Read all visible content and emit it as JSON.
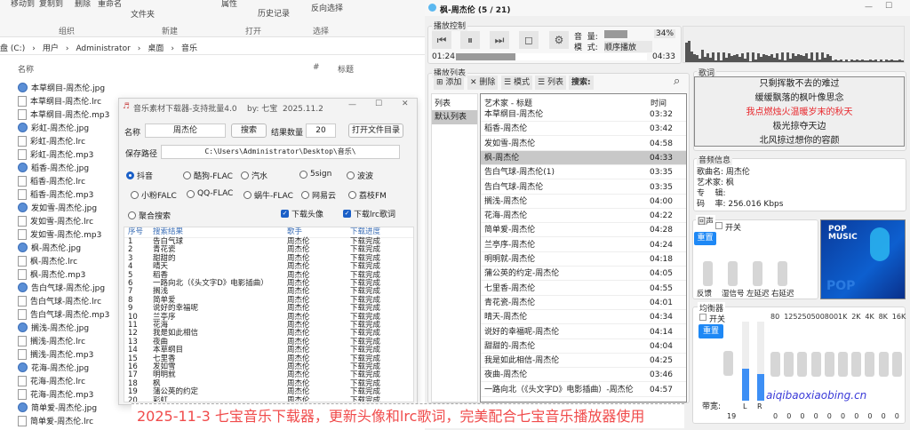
{
  "explorer": {
    "ribbon": {
      "move_to": "移动到",
      "copy_to": "复制到",
      "delete": "删除",
      "rename": "重命名",
      "new_folder": "文件夹",
      "new": "新建",
      "properties": "属性",
      "history": "历史记录",
      "invert_select": "反向选择"
    },
    "groups": [
      "组织",
      "新建",
      "打开",
      "选择"
    ],
    "address": [
      "盘 (C:)",
      "›",
      "用户",
      "›",
      "Administrator",
      "›",
      "桌面",
      "›",
      "音乐"
    ],
    "columns": {
      "name": "名称",
      "number": "#",
      "title": "标题"
    },
    "files": [
      {
        "name": "本草纲目-周杰伦.jpg",
        "type": "jpg"
      },
      {
        "name": "本草纲目-周杰伦.lrc",
        "type": "lrc"
      },
      {
        "name": "本草纲目-周杰伦.mp3",
        "type": "mp3"
      },
      {
        "name": "彩虹-周杰伦.jpg",
        "type": "jpg"
      },
      {
        "name": "彩虹-周杰伦.lrc",
        "type": "lrc"
      },
      {
        "name": "彩虹-周杰伦.mp3",
        "type": "mp3"
      },
      {
        "name": "稻香-周杰伦.jpg",
        "type": "jpg"
      },
      {
        "name": "稻香-周杰伦.lrc",
        "type": "lrc"
      },
      {
        "name": "稻香-周杰伦.mp3",
        "type": "mp3"
      },
      {
        "name": "发如雪-周杰伦.jpg",
        "type": "jpg"
      },
      {
        "name": "发如雪-周杰伦.lrc",
        "type": "lrc"
      },
      {
        "name": "发如雪-周杰伦.mp3",
        "type": "mp3"
      },
      {
        "name": "枫-周杰伦.jpg",
        "type": "jpg"
      },
      {
        "name": "枫-周杰伦.lrc",
        "type": "lrc"
      },
      {
        "name": "枫-周杰伦.mp3",
        "type": "mp3"
      },
      {
        "name": "告白气球-周杰伦.jpg",
        "type": "jpg"
      },
      {
        "name": "告白气球-周杰伦.lrc",
        "type": "lrc"
      },
      {
        "name": "告白气球-周杰伦.mp3",
        "type": "mp3"
      },
      {
        "name": "搁浅-周杰伦.jpg",
        "type": "jpg"
      },
      {
        "name": "搁浅-周杰伦.lrc",
        "type": "lrc"
      },
      {
        "name": "搁浅-周杰伦.mp3",
        "type": "mp3"
      },
      {
        "name": "花海-周杰伦.jpg",
        "type": "jpg"
      },
      {
        "name": "花海-周杰伦.lrc",
        "type": "lrc"
      },
      {
        "name": "花海-周杰伦.mp3",
        "type": "mp3"
      },
      {
        "name": "简单爱-周杰伦.jpg",
        "type": "jpg"
      },
      {
        "name": "简单爱-周杰伦.lrc",
        "type": "lrc"
      }
    ]
  },
  "downloader": {
    "title": "音乐素材下载器-支持批量4.0    by: 七宝  2025.11.2",
    "name_label": "名称",
    "name_value": "周杰伦",
    "search": "搜索",
    "count_label": "结果数量",
    "count_value": "20",
    "open_dir": "打开文件目录",
    "path_label": "保存路径",
    "path_value": "C:\\Users\\Administrator\\Desktop\\音乐\\",
    "sources": [
      "抖音",
      "酷狗-FLAC",
      "汽水",
      "5sign",
      "波波",
      "小粉FALC",
      "QQ-FLAC",
      "蜗牛-FLAC",
      "网易云",
      "荔枝FM",
      "聚合搜索"
    ],
    "selected_source": "抖音",
    "download_avatar": "下载头像",
    "download_lrc": "下载lrc歌词",
    "columns": [
      "序号",
      "搜索结果",
      "歌手",
      "下载进度"
    ],
    "rows": [
      [
        "1",
        "告白气球",
        "周杰伦",
        "下载完成"
      ],
      [
        "2",
        "青花瓷",
        "周杰伦",
        "下载完成"
      ],
      [
        "3",
        "甜甜的",
        "周杰伦",
        "下载完成"
      ],
      [
        "4",
        "晴天",
        "周杰伦",
        "下载完成"
      ],
      [
        "5",
        "稻香",
        "周杰伦",
        "下载完成"
      ],
      [
        "6",
        "一路向北（《头文字D》电影插曲）",
        "周杰伦",
        "下载完成"
      ],
      [
        "7",
        "搁浅",
        "周杰伦",
        "下载完成"
      ],
      [
        "8",
        "简单爱",
        "周杰伦",
        "下载完成"
      ],
      [
        "9",
        "说好的幸福呢",
        "周杰伦",
        "下载完成"
      ],
      [
        "10",
        "兰亭序",
        "周杰伦",
        "下载完成"
      ],
      [
        "11",
        "花海",
        "周杰伦",
        "下载完成"
      ],
      [
        "12",
        "我是如此相信",
        "周杰伦",
        "下载完成"
      ],
      [
        "13",
        "夜曲",
        "周杰伦",
        "下载完成"
      ],
      [
        "14",
        "本草纲目",
        "周杰伦",
        "下载完成"
      ],
      [
        "15",
        "七里香",
        "周杰伦",
        "下载完成"
      ],
      [
        "16",
        "发如雪",
        "周杰伦",
        "下载完成"
      ],
      [
        "17",
        "明明就",
        "周杰伦",
        "下载完成"
      ],
      [
        "18",
        "枫",
        "周杰伦",
        "下载完成"
      ],
      [
        "19",
        "蒲公英的约定",
        "周杰伦",
        "下载完成"
      ],
      [
        "20",
        "彩虹",
        "周杰伦",
        "下载完成"
      ]
    ]
  },
  "player": {
    "title": "枫-周杰伦 (5 / 21)",
    "control_label": "播放控制",
    "volume_label": "音  量:",
    "volume": "34%",
    "mode_label": "模  式:",
    "mode": "顺序播放",
    "elapsed": "01:24",
    "duration": "04:33",
    "progress": 0.31,
    "playlist_label": "播放列表",
    "toolbar": {
      "add": "添加",
      "delete": "删除",
      "mode": "模式",
      "list": "列表",
      "search": "搜索:"
    },
    "lists_header": "列表",
    "lists": [
      "默认列表"
    ],
    "columns": {
      "title": "艺术家 - 标题",
      "time": "时间"
    },
    "tracks": [
      [
        "本草纲目-周杰伦",
        "03:32"
      ],
      [
        "稻香-周杰伦",
        "03:42"
      ],
      [
        "发如雪-周杰伦",
        "04:58"
      ],
      [
        "枫-周杰伦",
        "04:33"
      ],
      [
        "告白气球-周杰伦(1)",
        "03:35"
      ],
      [
        "告白气球-周杰伦",
        "03:35"
      ],
      [
        "搁浅-周杰伦",
        "04:00"
      ],
      [
        "花海-周杰伦",
        "04:22"
      ],
      [
        "简单爱-周杰伦",
        "04:28"
      ],
      [
        "兰亭序-周杰伦",
        "04:24"
      ],
      [
        "明明就-周杰伦",
        "04:18"
      ],
      [
        "蒲公英的约定-周杰伦",
        "04:05"
      ],
      [
        "七里香-周杰伦",
        "04:55"
      ],
      [
        "青花瓷-周杰伦",
        "04:01"
      ],
      [
        "晴天-周杰伦",
        "04:34"
      ],
      [
        "说好的幸福呢-周杰伦",
        "04:14"
      ],
      [
        "甜甜的-周杰伦",
        "04:04"
      ],
      [
        "我是如此相信-周杰伦",
        "04:25"
      ],
      [
        "夜曲-周杰伦",
        "03:46"
      ],
      [
        "一路向北（《头文字D》电影插曲）-周杰伦",
        "04:57"
      ]
    ],
    "selected_track": 3,
    "lyrics_label": "歌词",
    "lyrics": [
      "只剩挥散不去的难过",
      "缓缓飘落的枫叶像思念",
      "我点燃烛火温暖岁末的秋天",
      "极光掠夺天边",
      "北风掠过想你的容颜"
    ],
    "current_lyric": 2,
    "info_label": "音频信息",
    "info": {
      "song": "歌曲名: 周杰伦",
      "artist": "艺术家: 枫",
      "album": "专    辑:",
      "bitrate": "码    率: 256.016 Kbps"
    },
    "reverb_label": "回声",
    "switch": "开关",
    "reset": "重置",
    "reverb_sliders": [
      "反馈",
      "湿信号",
      "左延迟",
      "右延迟"
    ],
    "album_art": {
      "line1": "POP",
      "line2": "MUSIC",
      "line3": "POP"
    },
    "eq_label": "均衡器",
    "eq_bands": [
      "80",
      "125",
      "250",
      "500",
      "800",
      "1K",
      "2K",
      "4K",
      "8K",
      "16K"
    ],
    "eq_values": [
      "0",
      "0",
      "0",
      "0",
      "0",
      "0",
      "0",
      "0",
      "0",
      "0"
    ],
    "bandwidth_label": "带宽:",
    "bandwidth_value": "19",
    "meter_l": "L",
    "meter_r": "R",
    "level_l": 0.4,
    "level_r": 0.34,
    "watermark": "aiqibaoxiaobing.cn"
  },
  "banner": "2025-11-3  七宝音乐下载器，更新头像和lrc歌词，完美配合七宝音乐播放器使用",
  "colors": {
    "accent": "#1a5fc7",
    "lyric_highlight": "#e8262b",
    "banner_text": "#f04b4b",
    "eq_button": "#1e88f5"
  }
}
